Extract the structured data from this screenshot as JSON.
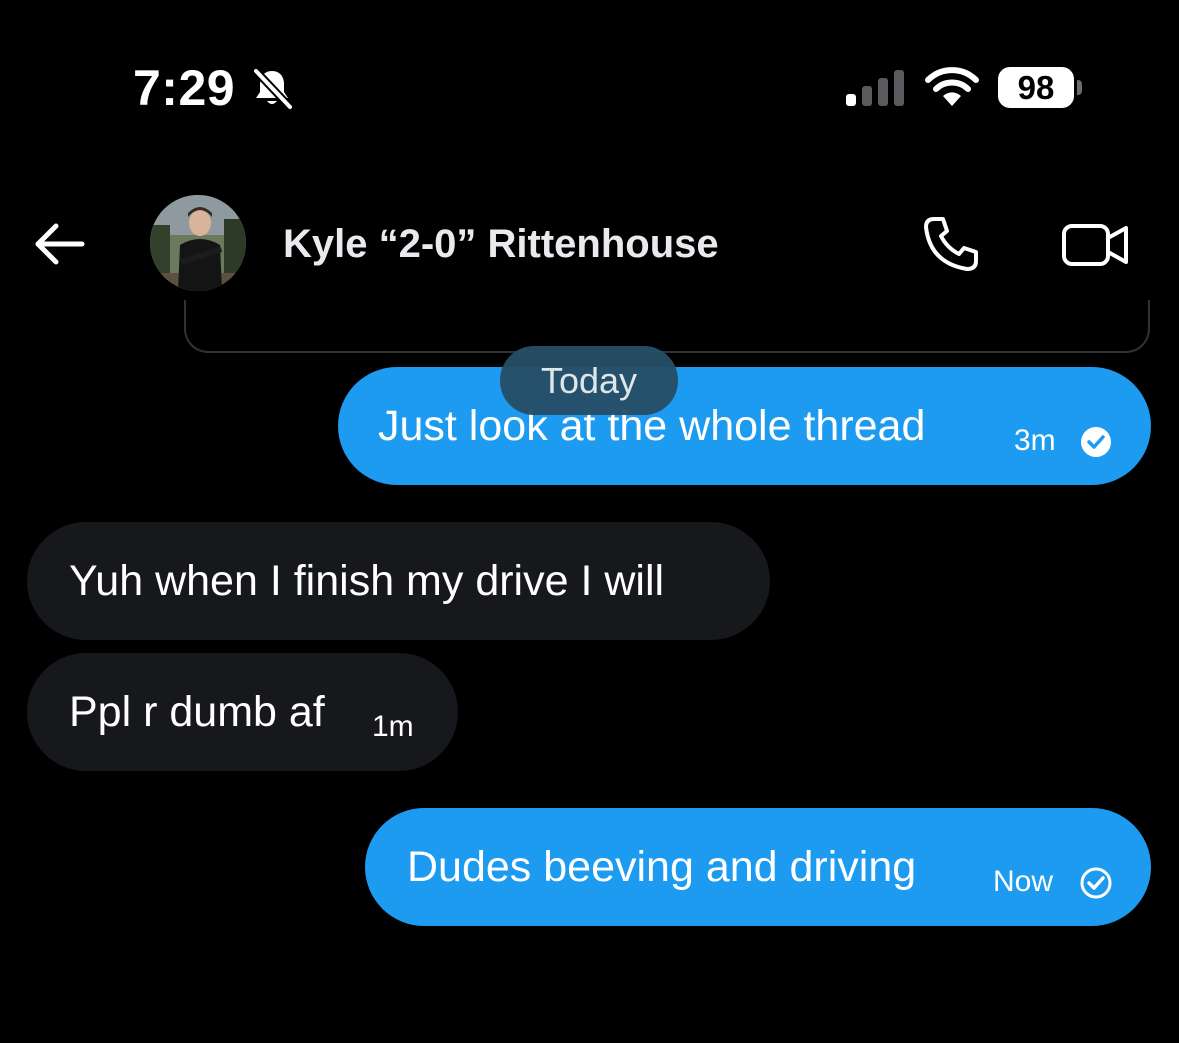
{
  "status_bar": {
    "time": "7:29",
    "battery": "98",
    "icons": [
      "bell-slash-icon",
      "signal-icon",
      "wifi-icon",
      "battery-icon"
    ]
  },
  "header": {
    "contact_name": "Kyle “2-0” Rittenhouse",
    "icons": [
      "back-arrow-icon",
      "phone-icon",
      "video-camera-icon"
    ]
  },
  "date_divider": "Today",
  "messages": [
    {
      "direction": "sent",
      "text": "Just look at the whole thread",
      "time": "3m",
      "status": "read-check-icon"
    },
    {
      "direction": "received",
      "text": "Yuh when I finish my drive I will",
      "time": ""
    },
    {
      "direction": "received",
      "text": "Ppl r dumb af",
      "time": "1m"
    },
    {
      "direction": "sent",
      "text": "Dudes beeving and driving",
      "time": "Now",
      "status": "sent-check-icon"
    }
  ],
  "colors": {
    "background": "#000000",
    "sent_bubble": "#1d9bf0",
    "received_bubble": "#16181c",
    "date_pill": "#264e67"
  }
}
